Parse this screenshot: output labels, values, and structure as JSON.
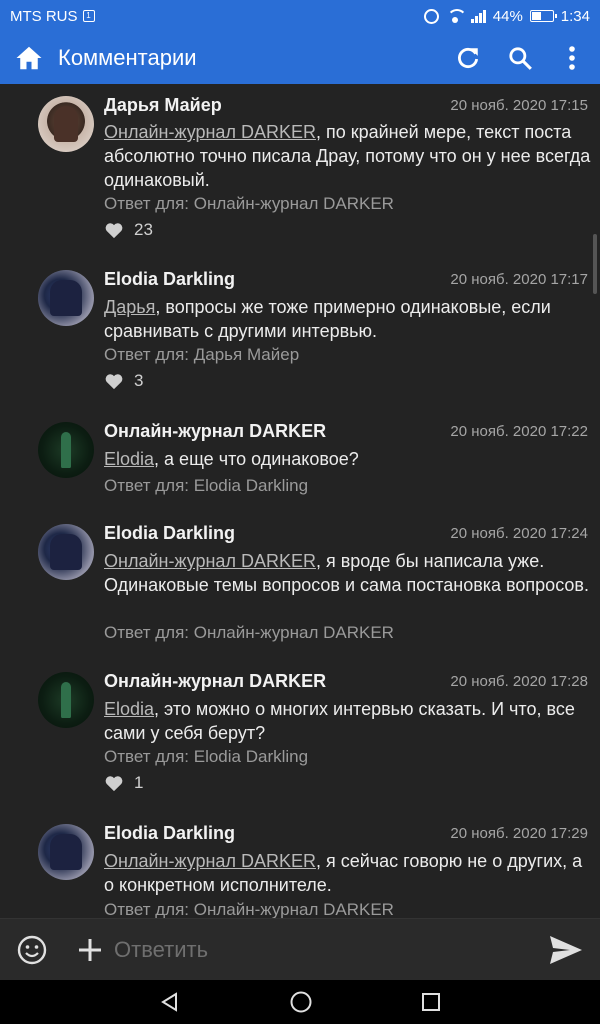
{
  "status_bar": {
    "carrier": "MTS RUS",
    "battery": "44%",
    "time": "1:34"
  },
  "toolbar": {
    "title": "Комментарии",
    "icons": [
      "home-icon",
      "refresh-icon",
      "search-icon",
      "more-vert-icon"
    ]
  },
  "comments": [
    {
      "author": "Дарья Майер",
      "date": "20 нояб. 2020 17:15",
      "mention": "Онлайн-журнал DARKER",
      "text": ", по крайней мере, текст поста абсолютно точно писала Драу, потому что он у нее всегда одинаковый.",
      "reply_to": "Ответ для: Онлайн-журнал DARKER",
      "likes": "23"
    },
    {
      "author": "Elodia Darkling",
      "date": "20 нояб. 2020 17:17",
      "mention": "Дарья",
      "text": ", вопросы же тоже примерно одинаковые, если сравнивать с другими интервью.",
      "reply_to": "Ответ для: Дарья Майер",
      "likes": "3"
    },
    {
      "author": "Онлайн-журнал DARKER",
      "date": "20 нояб. 2020 17:22",
      "mention": "Elodia",
      "text": ", а еще что одинаковое?",
      "reply_to": "Ответ для: Elodia Darkling",
      "likes": ""
    },
    {
      "author": "Elodia Darkling",
      "date": "20 нояб. 2020 17:24",
      "mention": "Онлайн-журнал DARKER",
      "text": ", я вроде бы написала уже. Одинаковые темы вопросов и сама постановка вопросов.",
      "reply_to": "Ответ для: Онлайн-журнал DARKER",
      "likes": ""
    },
    {
      "author": "Онлайн-журнал DARKER",
      "date": "20 нояб. 2020 17:28",
      "mention": "Elodia",
      "text": ", это можно о многих интервью сказать. И что, все сами у себя берут?",
      "reply_to": "Ответ для: Elodia Darkling",
      "likes": "1"
    },
    {
      "author": "Elodia Darkling",
      "date": "20 нояб. 2020 17:29",
      "mention": "Онлайн-журнал DARKER",
      "text": ", я сейчас говорю не о других, а о конкретном исполнителе.",
      "reply_to": "Ответ для: Онлайн-журнал DARKER",
      "likes": ""
    }
  ],
  "composer": {
    "placeholder": "Ответить"
  },
  "colors": {
    "accent": "#2a6ed6",
    "background": "#232323"
  }
}
